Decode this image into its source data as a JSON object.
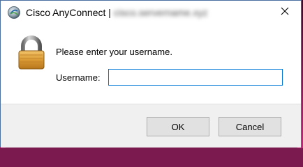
{
  "window": {
    "title": "Cisco AnyConnect |",
    "host": "cisco.servername.xyz"
  },
  "icons": {
    "app": "cisco-anyconnect-icon",
    "lock": "padlock-icon",
    "close": "close-icon"
  },
  "form": {
    "prompt": "Please enter your username.",
    "username_label": "Username:",
    "username_value": ""
  },
  "buttons": {
    "ok": "OK",
    "cancel": "Cancel"
  },
  "colors": {
    "input_focus_border": "#0078d7",
    "footer_bg": "#f0f0f0",
    "button_bg": "#e1e1e1"
  }
}
